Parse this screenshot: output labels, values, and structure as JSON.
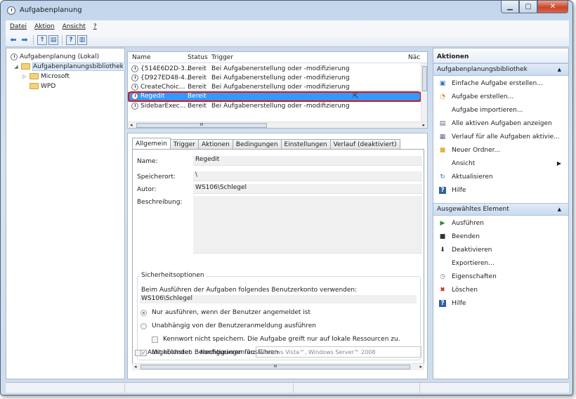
{
  "window": {
    "title": "Aufgabenplanung"
  },
  "menu": [
    "Datei",
    "Aktion",
    "Ansicht",
    "?"
  ],
  "tree": {
    "root": "Aufgabenplanung (Lokal)",
    "library": "Aufgabenplanungsbibliothek",
    "children": [
      "Microsoft",
      "WPD"
    ]
  },
  "tasklist": {
    "columns": [
      "Name",
      "Status",
      "Trigger",
      "Näc"
    ],
    "rows": [
      {
        "name": "{514E6D2D-3...",
        "status": "Bereit",
        "trigger": "Bei Aufgabenerstellung oder -modifizierung"
      },
      {
        "name": "{D927ED48-4...",
        "status": "Bereit",
        "trigger": "Bei Aufgabenerstellung oder -modifizierung"
      },
      {
        "name": "CreateChoic...",
        "status": "Bereit",
        "trigger": "Bei Aufgabenerstellung oder -modifizierung"
      },
      {
        "name": "Regedit",
        "status": "Bereit",
        "trigger": ""
      },
      {
        "name": "SidebarExec...",
        "status": "Bereit",
        "trigger": "Bei Aufgabenerstellung oder -modifizierung"
      }
    ],
    "selected_index": 3
  },
  "tabs": [
    "Allgemein",
    "Trigger",
    "Aktionen",
    "Bedingungen",
    "Einstellungen",
    "Verlauf (deaktiviert)"
  ],
  "general": {
    "name_label": "Name:",
    "name_value": "Regedit",
    "location_label": "Speicherort:",
    "location_value": "\\",
    "author_label": "Autor:",
    "author_value": "WS106\\Schlegel",
    "description_label": "Beschreibung:"
  },
  "security": {
    "title": "Sicherheitsoptionen",
    "account_prompt": "Beim Ausführen der Aufgaben folgendes Benutzerkonto verwenden:",
    "account": "WS106\\Schlegel",
    "opt1": "Nur ausführen, wenn der Benutzer angemeldet ist",
    "opt2": "Unabhängig von der Benutzeranmeldung ausführen",
    "opt3": "Kennwort nicht speichern. Die Aufgabe greift nur auf lokale Ressourcen zu.",
    "opt4": "Mit höchsten Berechtigungen ausführen"
  },
  "bottom": {
    "hidden": "Ausgeblendet",
    "configure_label": "Konfigurieren für:",
    "configure_value": "Windows Vista™, Windows Server™ 2008"
  },
  "actions": {
    "header": "Aktionen",
    "section1": "Aufgabenplanungsbibliothek",
    "items1": [
      "Einfache Aufgabe erstellen...",
      "Aufgabe erstellen...",
      "Aufgabe importieren...",
      "Alle aktiven Aufgaben anzeigen",
      "Verlauf für alle Aufgaben aktivie...",
      "Neuer Ordner...",
      "Ansicht",
      "Aktualisieren",
      "Hilfe"
    ],
    "section2": "Ausgewähltes Element",
    "items2": [
      "Ausführen",
      "Beenden",
      "Deaktivieren",
      "Exportieren...",
      "Eigenschaften",
      "Löschen",
      "Hilfe"
    ]
  },
  "scroll_glyph": "III"
}
